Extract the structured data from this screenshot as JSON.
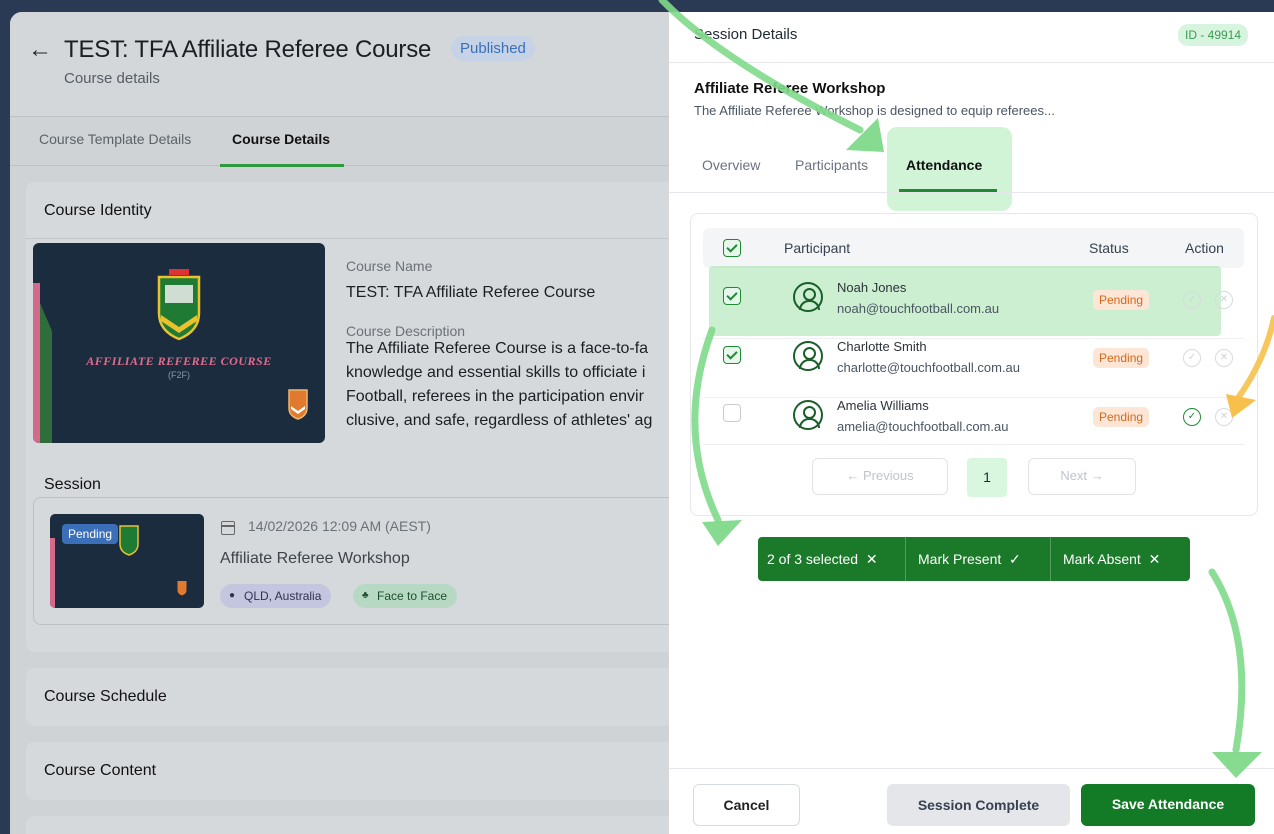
{
  "page": {
    "title": "TEST: TFA Affiliate Referee Course",
    "status_badge": "Published",
    "subtitle": "Course details",
    "tabs": [
      {
        "label": "Course Template Details"
      },
      {
        "label": "Course Details"
      }
    ],
    "identity": {
      "section_title": "Course Identity",
      "image_title": "AFFILIATE REFEREE COURSE",
      "image_subtitle": "(F2F)",
      "course_name_label": "Course Name",
      "course_name": "TEST: TFA Affiliate Referee Course",
      "course_description_label": "Course Description",
      "description_lines": [
        "The Affiliate Referee Course is a face-to-fa",
        "knowledge and essential skills to officiate i",
        "Football, referees in the participation envir",
        "clusive, and safe, regardless of athletes' ag"
      ]
    },
    "session": {
      "section_title": "Session",
      "tag": "Pending",
      "date": "14/02/2026 12:09 AM (AEST)",
      "name": "Affiliate Referee Workshop",
      "location": "QLD, Australia",
      "delivery": "Face to Face"
    },
    "schedule_title": "Course Schedule",
    "content_title": "Course Content"
  },
  "drawer": {
    "title": "Session Details",
    "id": "ID - 49914",
    "session_name": "Affiliate Referee Workshop",
    "session_description": "The Affiliate Referee Workshop is designed to equip referees...",
    "tabs": [
      {
        "label": "Overview"
      },
      {
        "label": "Participants"
      },
      {
        "label": "Attendance"
      }
    ],
    "table": {
      "headers": {
        "participant": "Participant",
        "status": "Status",
        "action": "Action"
      },
      "rows": [
        {
          "name": "Noah Jones",
          "email": "noah@touchfootball.com.au",
          "status": "Pending"
        },
        {
          "name": "Charlotte Smith",
          "email": "charlotte@touchfootball.com.au",
          "status": "Pending"
        },
        {
          "name": "Amelia Williams",
          "email": "amelia@touchfootball.com.au",
          "status": "Pending"
        }
      ]
    },
    "pagination": {
      "previous": "Previous",
      "page": "1",
      "next": "Next"
    },
    "bulk_bar": {
      "selected": "2 of 3 selected",
      "mark_present": "Mark Present",
      "mark_absent": "Mark Absent"
    },
    "buttons": {
      "cancel": "Cancel",
      "session_complete": "Session Complete",
      "save": "Save Attendance"
    }
  },
  "colors": {
    "accent_green": "#137a26",
    "pending_orange": "#d2691e",
    "published_blue": "#3b6fb8",
    "annotation_green": "#7fd98a",
    "annotation_yellow": "#f6c04a"
  }
}
